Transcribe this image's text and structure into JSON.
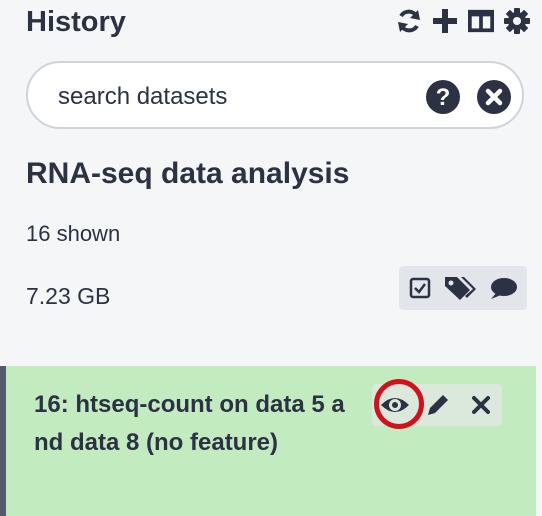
{
  "header": {
    "title": "History",
    "icons": [
      "sync-icon",
      "plus-icon",
      "columns-icon",
      "gear-icon"
    ]
  },
  "search": {
    "placeholder": "search datasets",
    "value": ""
  },
  "history": {
    "name": "RNA-seq data analysis",
    "shown": "16 shown",
    "size": "7.23 GB",
    "tool_icons": [
      "check-square-icon",
      "tags-icon",
      "comment-icon"
    ]
  },
  "dataset": {
    "title": "16: htseq-count on data 5 and data 8 (no feature)",
    "state_color": "#c2ebc0",
    "actions": [
      "eye-icon",
      "pencil-icon",
      "close-icon"
    ],
    "highlight_color": "#d4101b"
  }
}
